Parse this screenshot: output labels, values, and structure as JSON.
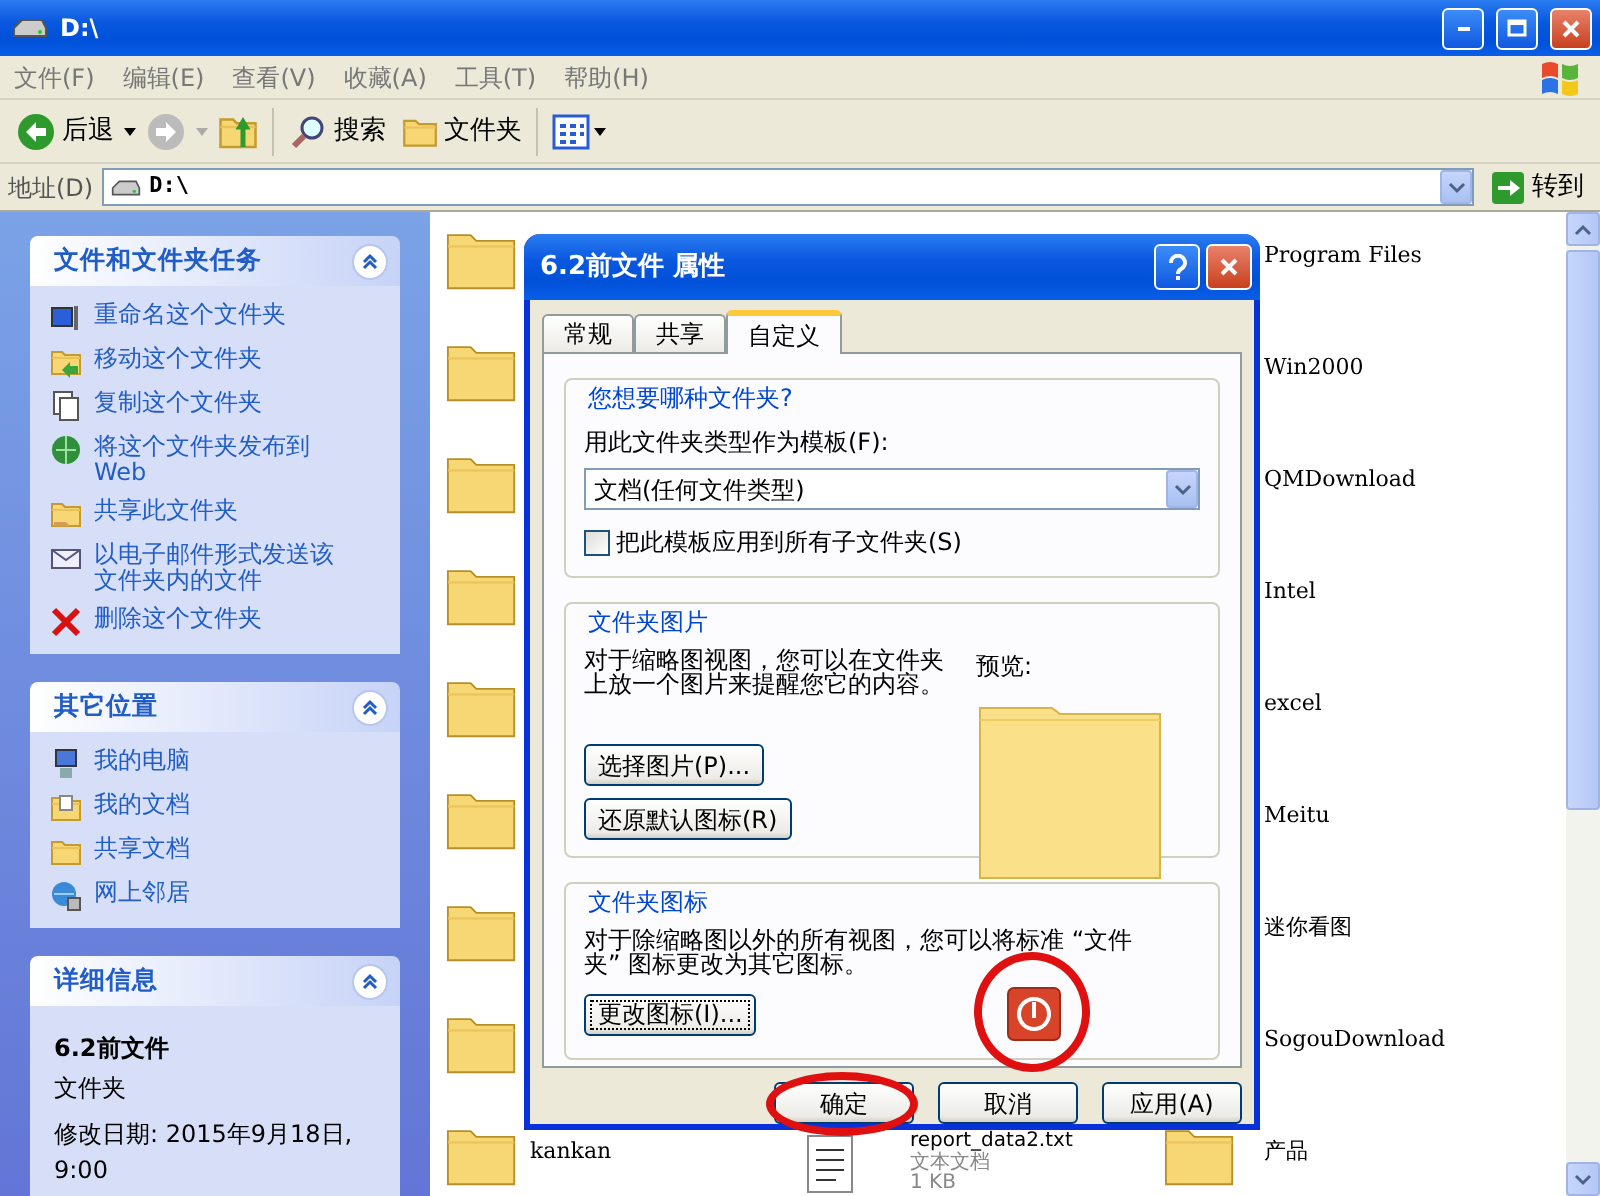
{
  "window": {
    "title": "D:\\"
  },
  "menu": [
    "文件(F)",
    "编辑(E)",
    "查看(V)",
    "收藏(A)",
    "工具(T)",
    "帮助(H)"
  ],
  "toolbar": {
    "back": "后退",
    "search": "搜索",
    "folders": "文件夹"
  },
  "address": {
    "label": "地址(D)",
    "value": "D:\\",
    "go": "转到"
  },
  "task_panes": [
    {
      "kind": "links",
      "title": "文件和文件夹任务",
      "items": [
        {
          "kind": "rename",
          "label": "重命名这个文件夹"
        },
        {
          "kind": "move",
          "label": "移动这个文件夹"
        },
        {
          "kind": "copy",
          "label": "复制这个文件夹"
        },
        {
          "kind": "publish",
          "label": "将这个文件夹发布到 Web"
        },
        {
          "kind": "share",
          "label": "共享此文件夹"
        },
        {
          "kind": "email",
          "label": "以电子邮件形式发送该文件夹内的文件"
        },
        {
          "kind": "delete",
          "label": "删除这个文件夹"
        }
      ]
    },
    {
      "kind": "links",
      "title": "其它位置",
      "items": [
        {
          "kind": "computer",
          "label": "我的电脑"
        },
        {
          "kind": "documents",
          "label": "我的文档"
        },
        {
          "kind": "shared",
          "label": "共享文档"
        },
        {
          "kind": "network",
          "label": "网上邻居"
        }
      ]
    },
    {
      "kind": "details",
      "title": "详细信息",
      "name": "6.2前文件",
      "type": "文件夹",
      "modified": "修改日期: 2015年9月18日, 9:00"
    }
  ],
  "files": {
    "column_1": [
      {
        "kind": "folder"
      },
      {
        "kind": "folder"
      },
      {
        "kind": "folder"
      },
      {
        "kind": "folder"
      },
      {
        "kind": "folder"
      },
      {
        "kind": "folder"
      },
      {
        "kind": "folder"
      },
      {
        "kind": "folder"
      },
      {
        "kind": "folder",
        "name": "kankan"
      }
    ],
    "column_2": [
      {
        "kind": "text",
        "name": "report_data2.txt",
        "type": "文本文档",
        "size": "1 KB"
      }
    ],
    "column_3": [
      {
        "name": "Program Files"
      },
      {
        "name": "Win2000"
      },
      {
        "name": "QMDownload"
      },
      {
        "name": "Intel"
      },
      {
        "name": "excel"
      },
      {
        "name": "Meitu"
      },
      {
        "name": "迷你看图"
      },
      {
        "name": "SogouDownload"
      },
      {
        "kind": "folder",
        "name": "产品"
      }
    ]
  },
  "dialog": {
    "title": "6.2前文件 属性",
    "tabs": [
      {
        "label": "常规",
        "selected": false
      },
      {
        "label": "共享",
        "selected": false
      },
      {
        "label": "自定义",
        "selected": true
      }
    ],
    "folder_type": {
      "title": "您想要哪种文件夹?",
      "template_label": "用此文件夹类型作为模板(F):",
      "template_value": "文档(任何文件类型)",
      "apply_all": {
        "label": "把此模板应用到所有子文件夹(S)",
        "checked": false
      }
    },
    "folder_picture": {
      "title": "文件夹图片",
      "description": "对于缩略图视图，您可以在文件夹上放一个图片来提醒您它的内容。",
      "preview_label": "预览:",
      "buttons": [
        "选择图片(P)...",
        "还原默认图标(R)"
      ]
    },
    "folder_icon": {
      "title": "文件夹图标",
      "description": "对于除缩略图以外的所有视图，您可以将标准 “文件夹” 图标更改为其它图标。",
      "button": "更改图标(I)...",
      "circled": true
    },
    "buttons": [
      {
        "label": "确定",
        "circled": true
      },
      {
        "label": "取消",
        "circled": false
      },
      {
        "label": "应用(A)",
        "circled": false
      }
    ]
  }
}
